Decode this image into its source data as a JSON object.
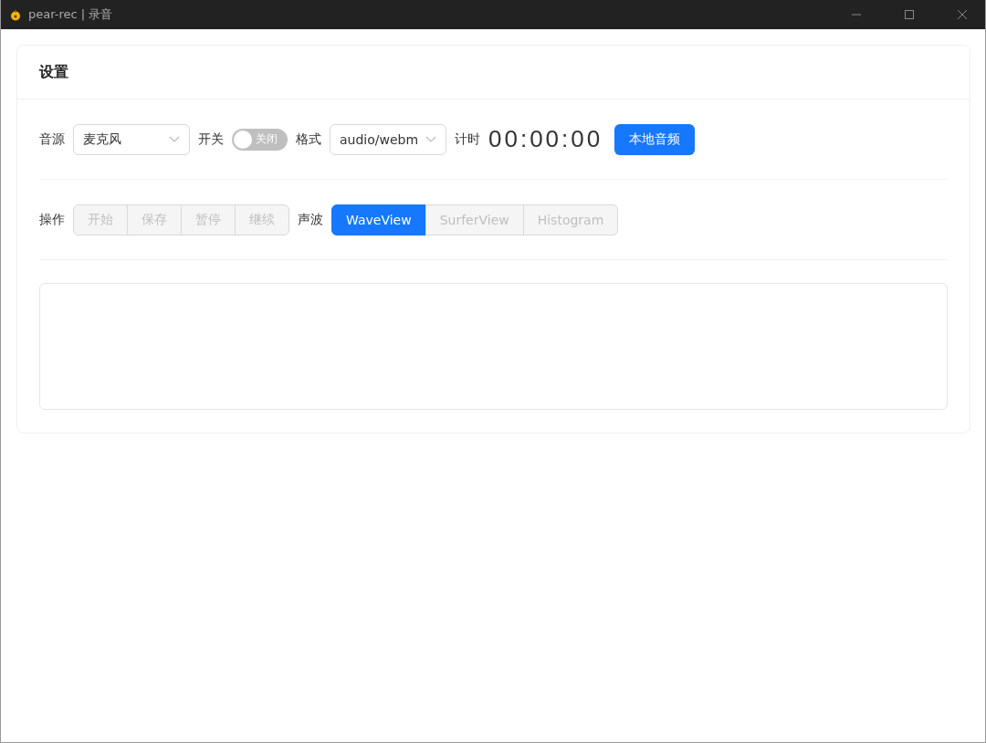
{
  "window": {
    "title": "pear-rec | 录音"
  },
  "card": {
    "title": "设置"
  },
  "settings": {
    "source": {
      "label": "音源",
      "value": "麦克风"
    },
    "switch": {
      "label": "开关",
      "text": "关闭",
      "on": false
    },
    "format": {
      "label": "格式",
      "value": "audio/webm"
    },
    "timer": {
      "label": "计时",
      "value": "00:00:00"
    },
    "local_button": "本地音频"
  },
  "actions": {
    "label": "操作",
    "buttons": [
      {
        "label": "开始",
        "disabled": true
      },
      {
        "label": "保存",
        "disabled": true
      },
      {
        "label": "暂停",
        "disabled": true
      },
      {
        "label": "继续",
        "disabled": true
      }
    ]
  },
  "waves": {
    "label": "声波",
    "options": [
      {
        "label": "WaveView",
        "selected": true,
        "disabled": false
      },
      {
        "label": "SurferView",
        "selected": false,
        "disabled": true
      },
      {
        "label": "Histogram",
        "selected": false,
        "disabled": true
      }
    ]
  }
}
